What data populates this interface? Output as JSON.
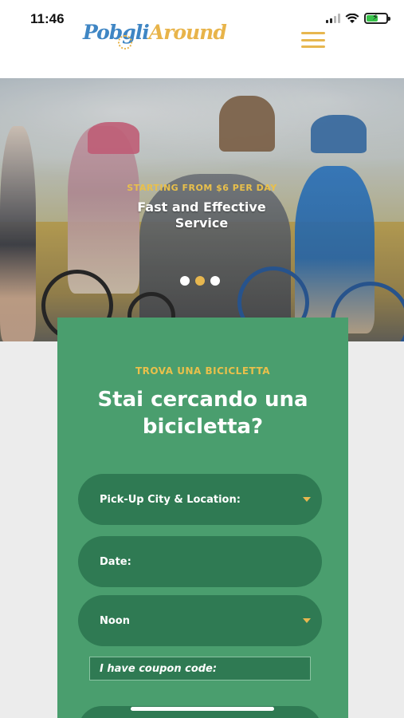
{
  "status_bar": {
    "time": "11:46"
  },
  "header": {
    "logo_part1": "Pobgli",
    "logo_part2": "Around",
    "menu_icon": "hamburger-menu-icon"
  },
  "hero": {
    "eyebrow": "STARTING FROM $6 PER DAY",
    "title": "Fast and Effective Service",
    "slides": {
      "count": 3,
      "active": 2
    }
  },
  "search_form": {
    "eyebrow": "TROVA UNA BICICLETTA",
    "title": "Stai cercando una bicicletta?",
    "location_label": "Pick-Up City & Location:",
    "date_label": "Date:",
    "time_value": "Noon",
    "coupon_label": "I have coupon code:"
  },
  "colors": {
    "accent_yellow": "#e7b74f",
    "card_green": "#4a9e6e",
    "field_green": "#2f7a53",
    "logo_blue": "#3f86c4"
  }
}
